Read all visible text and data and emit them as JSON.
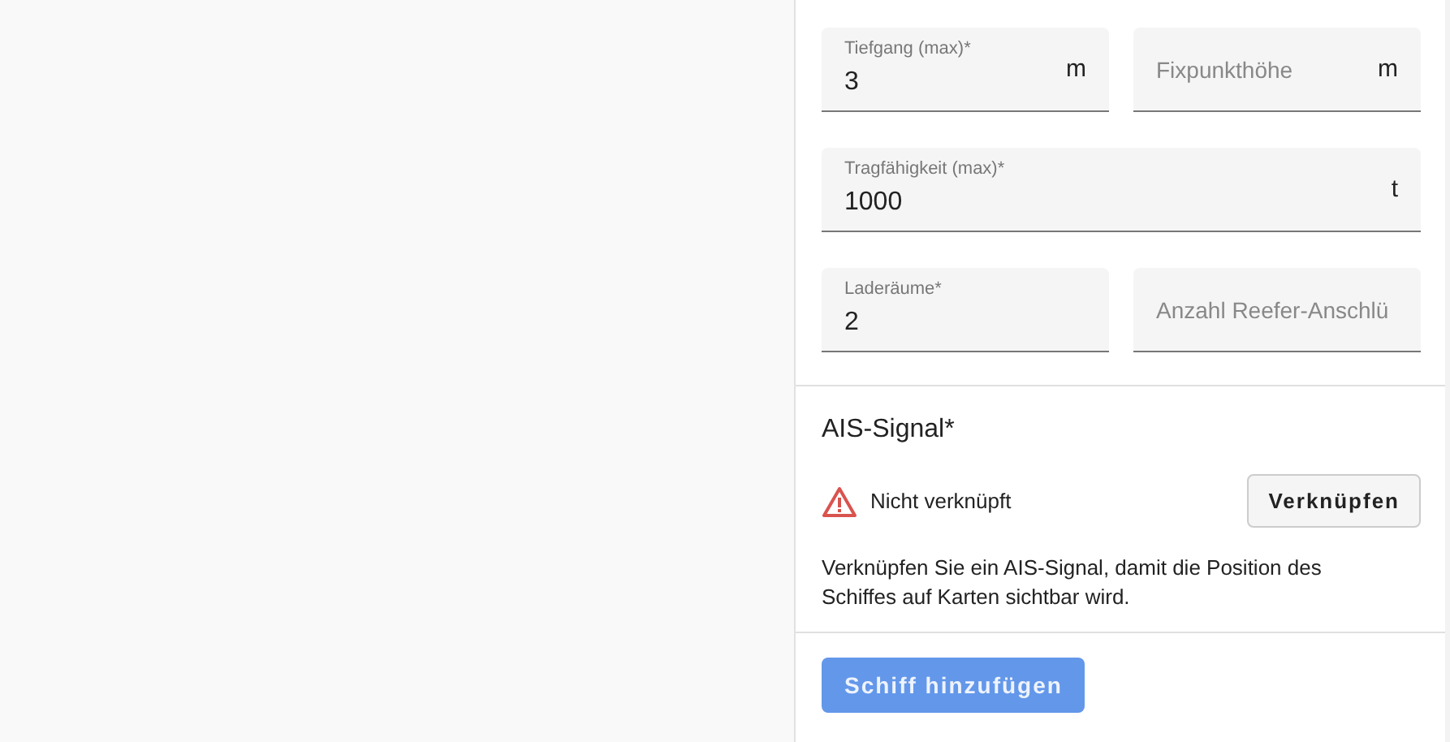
{
  "form": {
    "field_rows": [
      [
        {
          "label": "Tiefgang (max)*",
          "value": "3",
          "unit": "m"
        },
        {
          "placeholder": "Fixpunkthöhe",
          "unit": "m"
        }
      ],
      [
        {
          "label": "Tragfähigkeit (max)*",
          "value": "1000",
          "unit": "t"
        }
      ],
      [
        {
          "label": "Laderäume*",
          "value": "2"
        },
        {
          "placeholder": "Anzahl Reefer-Anschlü"
        }
      ]
    ]
  },
  "ais": {
    "title": "AIS-Signal*",
    "status": "Nicht verknüpft",
    "linked": false,
    "link_button": "Verknüpfen",
    "description": "Verknüpfen Sie ein AIS-Signal, damit die Position des Schiffes auf Karten sichtbar wird."
  },
  "submit_button": {
    "label": "Schiff hinzufügen",
    "disabled": true
  }
}
